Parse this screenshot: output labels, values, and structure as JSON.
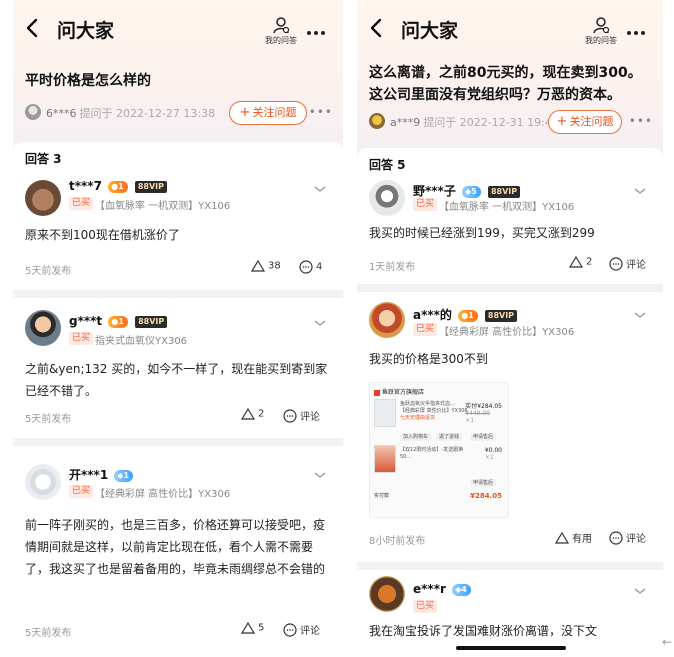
{
  "left": {
    "nav": {
      "title": "问大家",
      "my_questions": "我的问答"
    },
    "question": {
      "title": "平时价格是怎么样的",
      "asker": "6***6",
      "asked_at": "提问于 2022-12-27 13:38",
      "follow_label": "关注问题"
    },
    "answers_count": "回答 3",
    "answers": [
      {
        "user": "t***7",
        "level": "1",
        "vip": "88VIP",
        "bought": "已买",
        "sku": "【血氧脉率 一机双测】YX106",
        "text": "原来不到100现在借机涨价了",
        "time": "5天前发布",
        "useful": "38",
        "comments": "4"
      },
      {
        "user": "g***t",
        "level": "1",
        "vip": "88VIP",
        "bought": "已买",
        "sku": "指夹式血氧仪YX306",
        "text": "之前&yen;132 买的，如今不一样了，现在能买到寄到家已经不错了。",
        "time": "5天前发布",
        "useful": "2",
        "comments": "评论"
      },
      {
        "user": "开***1",
        "level": "1",
        "bought": "已买",
        "sku": "【经典彩屏 高性价比】YX306",
        "text": "前一阵子刚买的，也是三百多，价格还算可以接受吧，疫情期间就是这样，以前肯定比现在低，看个人需不需要了，我这买了也是留着备用的，毕竟未雨绸缪总不会错的",
        "time": "5天前发布",
        "useful": "5",
        "comments": "评论"
      }
    ]
  },
  "right": {
    "nav": {
      "title": "问大家",
      "my_questions": "我的问答"
    },
    "question": {
      "title": "这么离谱，之前80元买的，现在卖到300。这公司里面没有党组织吗？万恶的资本。",
      "asker": "a***9",
      "asked_at": "提问于 2022-12-31 19:43",
      "follow_label": "关注问题"
    },
    "answers_count": "回答 5",
    "answers": [
      {
        "user": "野***子",
        "level": "5",
        "vip": "88VIP",
        "bought": "已买",
        "sku": "【血氧脉率 一机双测】YX106",
        "text": "我买的时候已经涨到199，买完又涨到299",
        "time": "1天前发布",
        "useful": "2",
        "comments": "评论"
      },
      {
        "user": "a***的",
        "level": "1",
        "vip": "88VIP",
        "bought": "已买",
        "sku": "【经典彩屏 高性价比】YX306",
        "text": "我买的价格是300不到",
        "time": "8小时前发布",
        "useful": "有用",
        "comments": "评论",
        "image": {
          "store": "鱼跃官方旗舰店",
          "item1_name": "鱼跃血氧仪手指夹式血…",
          "item1_spec": "【经典彩屏 高性价比】YX306",
          "item1_price": "实付¥284.05",
          "item1_orig": "¥449.00",
          "item1_qty": "×1",
          "item1_tag": "七天无理由退货",
          "btn_cart": "加入购物车",
          "btn_refund": "退了退钱",
          "btn_after": "申请售后",
          "item2_name": "【双12限时活动】-发送跟换50…",
          "item2_price": "¥0.00",
          "item2_qty": "×1",
          "btn_after2": "申请售后",
          "total_label": "实付款",
          "total": "¥284.05"
        }
      },
      {
        "user": "e***r",
        "level": "4",
        "bought": "已买",
        "text": "我在淘宝投诉了发国难财涨价离谱，没下文"
      }
    ]
  },
  "colors": {
    "accent": "#e8531e",
    "vip_bg": "#2b2b2b",
    "bought": "#ff5a36"
  }
}
